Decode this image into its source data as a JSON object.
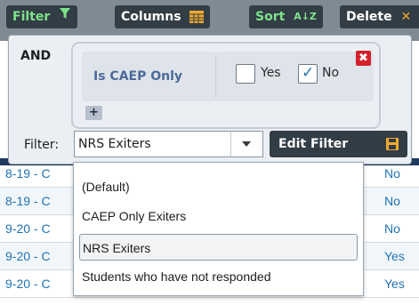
{
  "toolbar": {
    "filter_label": "Filter",
    "columns_label": "Columns",
    "sort_label": "Sort",
    "sort_glyph": "A↓Z",
    "delete_label": "Delete"
  },
  "grid": {
    "rows": [
      {
        "left": "8-19 - C",
        "right": "No"
      },
      {
        "left": "8-19 - C",
        "right": "No"
      },
      {
        "left": "9-20 - C",
        "right": "No"
      },
      {
        "left": "9-20 - C",
        "right": "Yes"
      },
      {
        "left": "9-20 - C",
        "right": "Yes"
      }
    ]
  },
  "filter_panel": {
    "operator": "AND",
    "condition": {
      "field": "Is CAEP Only",
      "options": [
        {
          "label": "Yes",
          "checked": false
        },
        {
          "label": "No",
          "checked": true
        }
      ],
      "remove_glyph": "✖"
    },
    "add_glyph": "+",
    "filter_label": "Filter:",
    "selected_filter": "NRS Exiters",
    "edit_label": "Edit Filter"
  },
  "dropdown": {
    "options": [
      "(Default)",
      "CAEP Only Exiters",
      "NRS Exiters",
      "Students who have not responded"
    ],
    "selected_index": 2
  },
  "colors": {
    "toolbar_bg": "#7f8b94",
    "button_bg": "#333d45",
    "green_icon": "#7ee38b",
    "orange_icon": "#f0a92e",
    "link_blue": "#1f73b7",
    "remove_red": "#d3202a",
    "field_blue": "#4b6a9b"
  },
  "icons": {
    "filter": "filter-funnel-icon",
    "columns": "columns-grid-icon",
    "sort": "sort-alpha-icon",
    "delete": "delete-x-icon",
    "edit": "save-disk-icon",
    "dropdown": "chevron-down-icon"
  }
}
